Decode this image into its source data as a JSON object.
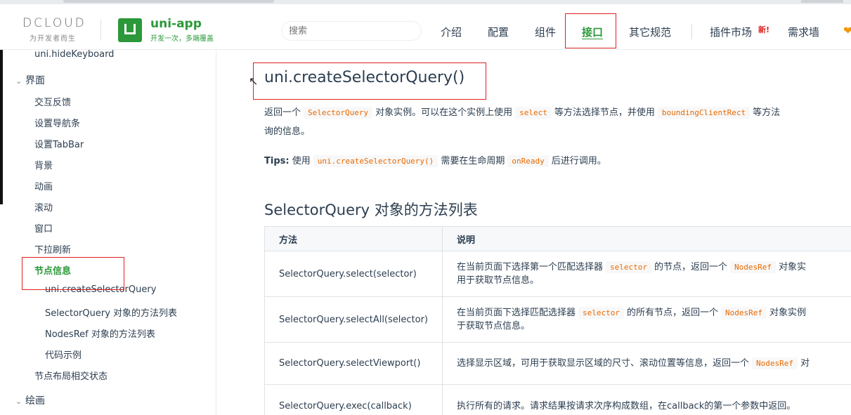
{
  "header": {
    "dcloud_logo": "DCLOUD",
    "dcloud_slogan": "为开发者而生",
    "uni_title": "uni-app",
    "uni_subtitle": "开发一次，多端覆盖",
    "search_placeholder": "搜索",
    "nav": [
      "介绍",
      "配置",
      "组件",
      "接口",
      "其它规范",
      "插件市场",
      "需求墙"
    ],
    "active_nav": "接口",
    "new_badge": "新!"
  },
  "sidebar": {
    "top_item": "uni.hideKeyboard",
    "group_ui": "界面",
    "items_l1": [
      "交互反馈",
      "设置导航条",
      "设置TabBar",
      "背景",
      "动画",
      "滚动",
      "窗口",
      "下拉刷新"
    ],
    "active_item": "节点信息",
    "items_l2": [
      "uni.createSelectorQuery",
      "SelectorQuery 对象的方法列表",
      "NodesRef 对象的方法列表",
      "代码示例"
    ],
    "after_item": "节点布局相交状态",
    "group_draw": "绘画"
  },
  "main": {
    "title": "uni.createSelectorQuery()",
    "desc_1": "返回一个",
    "desc_code_1": "SelectorQuery",
    "desc_2": "对象实例。可以在这个实例上使用",
    "desc_code_2": "select",
    "desc_3": "等方法选择节点，并使用",
    "desc_code_3": "boundingClientRect",
    "desc_4": "等方法",
    "desc_line2": "询的信息。",
    "tips_label": "Tips:",
    "tips_1": "使用",
    "tips_code_1": "uni.createSelectorQuery()",
    "tips_2": "需要在生命周期",
    "tips_code_2": "onReady",
    "tips_3": "后进行调用。",
    "section_title": "SelectorQuery 对象的方法列表",
    "table": {
      "headers": [
        "方法",
        "说明"
      ],
      "rows": [
        {
          "method": "SelectorQuery.select(selector)",
          "d1a": "在当前页面下选择第一个匹配选择器",
          "d1code": "selector",
          "d1b": "的节点，返回一个",
          "d1code2": "NodesRef",
          "d1c": "对象实",
          "d2": "用于获取节点信息。"
        },
        {
          "method": "SelectorQuery.selectAll(selector)",
          "d1a": "在当前页面下选择匹配选择器",
          "d1code": "selector",
          "d1b": "的所有节点，返回一个",
          "d1code2": "NodesRef",
          "d1c": "对象实例",
          "d2": "于获取节点信息。"
        },
        {
          "method": "SelectorQuery.selectViewport()",
          "d1a": "选择显示区域，可用于获取显示区域的尺寸、滚动位置等信息，返回一个",
          "d1code2": "NodesRef",
          "d1c": "对"
        },
        {
          "method": "SelectorQuery.exec(callback)",
          "d1a": "执行所有的请求。请求结果按请求次序构成数组，在callback的第一个参数中返回。"
        }
      ]
    }
  },
  "colors": {
    "brand": "#2b9939",
    "code": "#e96900",
    "annotation": "#e02020"
  }
}
